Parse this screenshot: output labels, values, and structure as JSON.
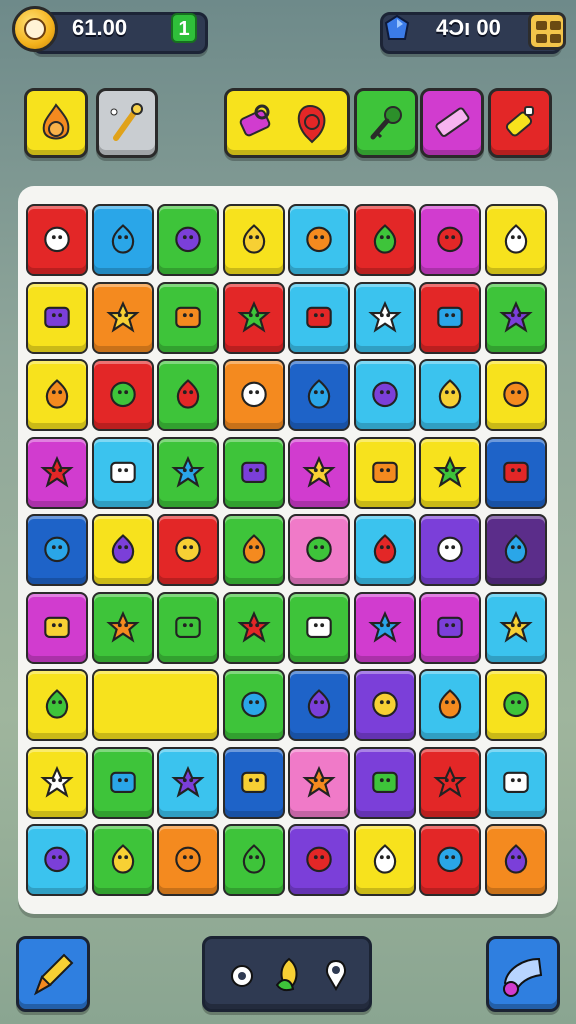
{
  "hud": {
    "coins_value": "61.00",
    "plus_label": "1",
    "gems_value": "4Ɔı 00"
  },
  "colors": {
    "red": "#e32727",
    "blue": "#2aa6e8",
    "green": "#3ec43a",
    "yellow": "#f7e21d",
    "cyan": "#3bc3ee",
    "magenta": "#d13ccf",
    "orange": "#f48a1f",
    "purple": "#7b3fd9",
    "darkpurple": "#5b2d8a",
    "darkblue": "#1e63c8",
    "pink": "#f07ac8",
    "lime": "#7ed32a"
  },
  "toolbar": [
    {
      "name": "flame-pot-icon",
      "color": "yellow"
    },
    {
      "name": "wand-icon",
      "color": "gray"
    },
    {
      "name": "key-pair-icon",
      "color": "yellow"
    },
    {
      "name": "key-icon",
      "color": "green"
    },
    {
      "name": "eraser-icon",
      "color": "magenta"
    },
    {
      "name": "glue-icon",
      "color": "red"
    }
  ],
  "grid": [
    [
      "red",
      "blue",
      "green",
      "yellow",
      "cyan",
      "red",
      "magenta",
      "yellow"
    ],
    [
      "yellow",
      "orange",
      "green",
      "red",
      "cyan",
      "cyan",
      "red",
      "green"
    ],
    [
      "yellow",
      "red",
      "green",
      "orange",
      "darkblue",
      "cyan",
      "cyan",
      "yellow"
    ],
    [
      "magenta",
      "cyan",
      "green",
      "green",
      "magenta",
      "yellow",
      "yellow",
      "darkblue"
    ],
    [
      "darkblue",
      "yellow",
      "red",
      "green",
      "pink",
      "cyan",
      "purple",
      "darkpurple"
    ],
    [
      "magenta",
      "green",
      "green",
      "green",
      "green",
      "magenta",
      "magenta",
      "cyan"
    ],
    [
      "yellow",
      "empty-yellow",
      "empty-yellow",
      "green",
      "darkblue",
      "purple",
      "cyan",
      "yellow"
    ],
    [
      "yellow",
      "green",
      "cyan",
      "darkblue",
      "pink",
      "purple",
      "red",
      "cyan"
    ],
    [
      "cyan",
      "green",
      "orange",
      "green",
      "purple",
      "yellow",
      "red",
      "orange"
    ]
  ],
  "grid_icons": [
    [
      "sprout-icon",
      "box-icon",
      "house-icon",
      "spiral-icon",
      "face-icon",
      "flag-icon",
      "ghost-icon",
      "figure-icon"
    ],
    [
      "blob-icon",
      "crayon-icon",
      "cube-icon",
      "ghost-icon",
      "dots-icon",
      "phone-icon",
      "robot-icon",
      "hook-icon"
    ],
    [
      "leaf-icon",
      "apple-icon",
      "pot-icon",
      "heart-icon",
      "fish-icon",
      "arrow-icon",
      "bell-icon",
      "splash-icon"
    ],
    [
      "knot-icon",
      "star-burst-icon",
      "drum-icon",
      "leaf-icon",
      "calendar-icon",
      "ticket-icon",
      "bulb-icon",
      "gear-icon"
    ],
    [
      "shell-icon",
      "star-icon",
      "card-icon",
      "smile-icon",
      "cross-icon",
      "letter-a-icon",
      "box-face-icon",
      "star-icon"
    ],
    [
      "ruler-icon",
      "pencil-icon",
      "rocket-icon",
      "map-pin-icon",
      "heart-icon",
      "card-icon",
      "brush-icon",
      "scale-icon"
    ],
    [
      "drop-icon",
      "blank",
      "blank",
      "brush-icon",
      "skull-icon",
      "ticket-icon",
      "glove-icon",
      "flower-icon"
    ],
    [
      "jar-icon",
      "frog-icon",
      "cloud-face-icon",
      "feather-icon",
      "hammer-icon",
      "pen-icon",
      "cactus-icon",
      "burst-icon"
    ],
    [
      "pin-icon",
      "house-icon",
      "lantern-icon",
      "sun-gear-icon",
      "wand-icon",
      "basket-icon",
      "dropper-icon",
      "flame-icon"
    ]
  ],
  "bottom": {
    "left_button": "pencil-icon",
    "center_items": [
      "gear-icon",
      "leaf-icon",
      "pin-icon"
    ],
    "right_button": "horn-icon"
  }
}
